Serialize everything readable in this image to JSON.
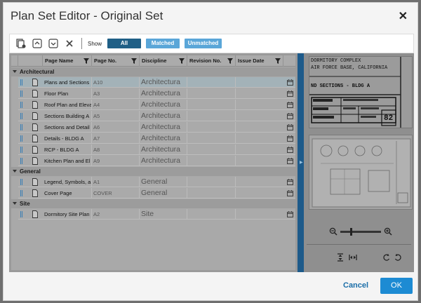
{
  "dialog": {
    "title": "Plan Set Editor - Original Set",
    "close_icon": "close-icon"
  },
  "toolbar": {
    "icons": [
      "add-sheets-icon",
      "move-up-icon",
      "move-down-icon",
      "delete-icon"
    ],
    "show_label": "Show",
    "filters": [
      "All",
      "Matched",
      "Unmatched"
    ],
    "active_filter": "All"
  },
  "grid": {
    "columns": [
      "Page Name",
      "Page No.",
      "Discipline",
      "Revision No.",
      "Issue Date"
    ],
    "groups": [
      {
        "name": "Architectural",
        "rows": [
          {
            "name": "Plans and Sections",
            "page_no": "A10",
            "discipline": "Architectura",
            "revision": "",
            "selected": true
          },
          {
            "name": "Floor Plan",
            "page_no": "A3",
            "discipline": "Architectura",
            "revision": "",
            "selected": false
          },
          {
            "name": "Roof Plan and Eleva",
            "page_no": "A4",
            "discipline": "Architectura",
            "revision": "",
            "selected": false
          },
          {
            "name": "Sections Building A",
            "page_no": "A5",
            "discipline": "Architectura",
            "revision": "",
            "selected": false
          },
          {
            "name": "Sections and Detail",
            "page_no": "A6",
            "discipline": "Architectura",
            "revision": "",
            "selected": false
          },
          {
            "name": "Details - BLDG A",
            "page_no": "A7",
            "discipline": "Architectura",
            "revision": "",
            "selected": false
          },
          {
            "name": "RCP - BLDG A",
            "page_no": "A8",
            "discipline": "Architectura",
            "revision": "",
            "selected": false
          },
          {
            "name": "Kitchen Plan and El",
            "page_no": "A9",
            "discipline": "Architectura",
            "revision": "",
            "selected": false
          }
        ]
      },
      {
        "name": "General",
        "rows": [
          {
            "name": "Legend, Symbols, a",
            "page_no": "A1",
            "discipline": "General",
            "revision": "",
            "selected": false
          },
          {
            "name": "Cover Page",
            "page_no": "COVER",
            "discipline": "General",
            "revision": "",
            "selected": false
          }
        ]
      },
      {
        "name": "Site",
        "rows": [
          {
            "name": "Dormitory Site Plan",
            "page_no": "A2",
            "discipline": "Site",
            "revision": "",
            "selected": false
          }
        ]
      }
    ]
  },
  "preview": {
    "title_block_lines": [
      "DORMITORY COMPLEX",
      "AIR FORCE BASE, CALIFORNIA",
      "ND SECTIONS - BLDG A"
    ],
    "sheet_number": "82",
    "zoom_out_icon": "zoom-out-icon",
    "zoom_in_icon": "zoom-in-icon",
    "zoom_level": 0.25
  },
  "footer": {
    "cancel_label": "Cancel",
    "ok_label": "OK"
  },
  "colors": {
    "accent": "#1d8bd3",
    "filter_active": "#1f5f86",
    "filter_inactive": "#5aa6d8",
    "splitter": "#1d5a8a"
  }
}
